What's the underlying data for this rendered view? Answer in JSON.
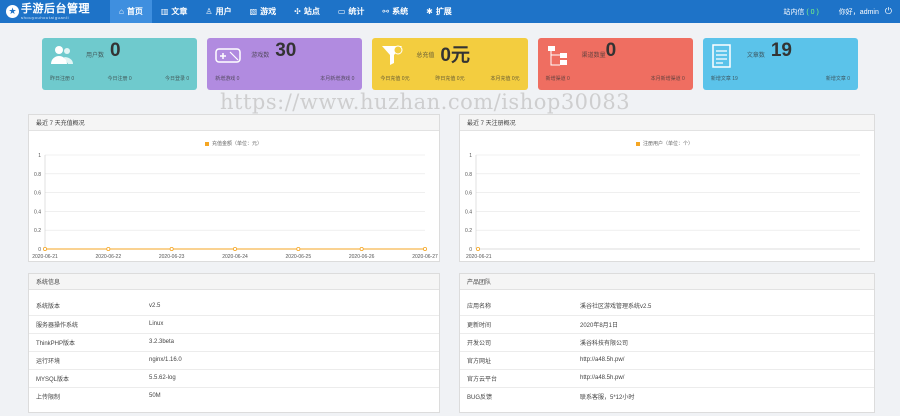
{
  "nav": {
    "logo_title": "手游后台管理",
    "logo_sub": "shouyouhoutaiguanli",
    "items": [
      {
        "label": "首页",
        "icon": "home-icon",
        "glyph": "⌂"
      },
      {
        "label": "文章",
        "icon": "bar-chart-icon",
        "glyph": "▥"
      },
      {
        "label": "用户",
        "icon": "user-icon",
        "glyph": "♙"
      },
      {
        "label": "游戏",
        "icon": "game-icon",
        "glyph": "▧"
      },
      {
        "label": "站点",
        "icon": "sitemap-icon",
        "glyph": "✣"
      },
      {
        "label": "统计",
        "icon": "monitor-icon",
        "glyph": "▭"
      },
      {
        "label": "系统",
        "icon": "link-icon",
        "glyph": "⚯"
      },
      {
        "label": "扩展",
        "icon": "gear-icon",
        "glyph": "✱"
      }
    ],
    "msg_label": "站内信",
    "msg_count": "( 0 )",
    "welcome": "你好，admin",
    "logout_glyph": "⏻"
  },
  "cards": [
    {
      "label": "用户数",
      "value": "0",
      "subs": [
        "昨日注册 0",
        "今日注册 0",
        "今日登录 0"
      ],
      "color": "#6fcacd",
      "icon": "users-icon"
    },
    {
      "label": "游戏数",
      "value": "30",
      "subs": [
        "新增游戏 0",
        "本月新增游戏 0"
      ],
      "color": "#b18be0",
      "icon": "gamepad-icon"
    },
    {
      "label": "总充值",
      "value": "0元",
      "subs": [
        "今日充值 0元",
        "昨日充值 0元",
        "本月充值 0元"
      ],
      "color": "#f3cd3f",
      "icon": "funnel-icon"
    },
    {
      "label": "渠道数量",
      "value": "0",
      "subs": [
        "新增渠道 0",
        "本月新增渠道 0"
      ],
      "color": "#ef6e61",
      "icon": "tree-icon"
    },
    {
      "label": "文章数",
      "value": "19",
      "subs": [
        "新增文章 19",
        "新增文章 0"
      ],
      "color": "#5bc3ea",
      "icon": "document-icon"
    }
  ],
  "watermark": "https://www.huzhan.com/ishop30083",
  "chart1": {
    "title": "最近 7 天充值概况",
    "legend": "充值金额（单位：元）"
  },
  "chart2": {
    "title": "最近 7 天注册概况",
    "legend": "注册用户（单位：个）"
  },
  "chart_data": [
    {
      "type": "line",
      "title": "最近 7 天充值概况",
      "x": [
        "2020-06-21",
        "2020-06-22",
        "2020-06-23",
        "2020-06-24",
        "2020-06-25",
        "2020-06-26",
        "2020-06-27"
      ],
      "series": [
        {
          "name": "充值金额（单位：元）",
          "values": [
            0,
            0,
            0,
            0,
            0,
            0,
            0
          ]
        }
      ],
      "ylim": [
        0,
        1
      ],
      "yticks": [
        0,
        0.2,
        0.4,
        0.6,
        0.8,
        1
      ],
      "ytick_labels": [
        "0",
        "0.2",
        "0.4",
        "0.6",
        "0.8",
        "1"
      ],
      "xtick_labels": [
        "2020-06-21",
        "2020-06-22",
        "2020-06-23",
        "2020-06-24",
        "2020-06-25",
        "2020-06-26",
        "2020-06-27"
      ],
      "color": "#f5a623",
      "grid": true
    },
    {
      "type": "line",
      "title": "最近 7 天注册概况",
      "x": [
        "2020-06-21"
      ],
      "series": [
        {
          "name": "注册用户（单位：个）",
          "values": [
            0
          ]
        }
      ],
      "ylim": [
        0,
        1
      ],
      "yticks": [
        0,
        0.2,
        0.4,
        0.6,
        0.8,
        1
      ],
      "ytick_labels": [
        "0",
        "0.2",
        "0.4",
        "0.6",
        "0.8",
        "1"
      ],
      "xtick_labels": [
        "2020-06-21"
      ],
      "color": "#f5a623",
      "grid": true
    }
  ],
  "sysinfo": {
    "title": "系统信息",
    "rows": [
      {
        "k": "系统版本",
        "v": "v2.5"
      },
      {
        "k": "服务器操作系统",
        "v": "Linux"
      },
      {
        "k": "ThinkPHP版本",
        "v": "3.2.3beta"
      },
      {
        "k": "运行环境",
        "v": "nginx/1.16.0"
      },
      {
        "k": "MYSQL版本",
        "v": "5.5.62-log"
      },
      {
        "k": "上传限制",
        "v": "50M"
      }
    ]
  },
  "team": {
    "title": "产品团队",
    "rows": [
      {
        "k": "应用名称",
        "v": "溪谷社区游戏管理系统v2.5",
        "link": false
      },
      {
        "k": "更新时间",
        "v": "2020年8月1日",
        "link": false
      },
      {
        "k": "开发公司",
        "v": "溪谷科技有限公司",
        "link": false
      },
      {
        "k": "官方网址",
        "v": "http://a48.5h.pw/",
        "link": true
      },
      {
        "k": "官方云平台",
        "v": "http://a48.5h.pw/",
        "link": true
      },
      {
        "k": "BUG反馈",
        "v": "联系客服，5*12小时",
        "link": false
      }
    ]
  }
}
